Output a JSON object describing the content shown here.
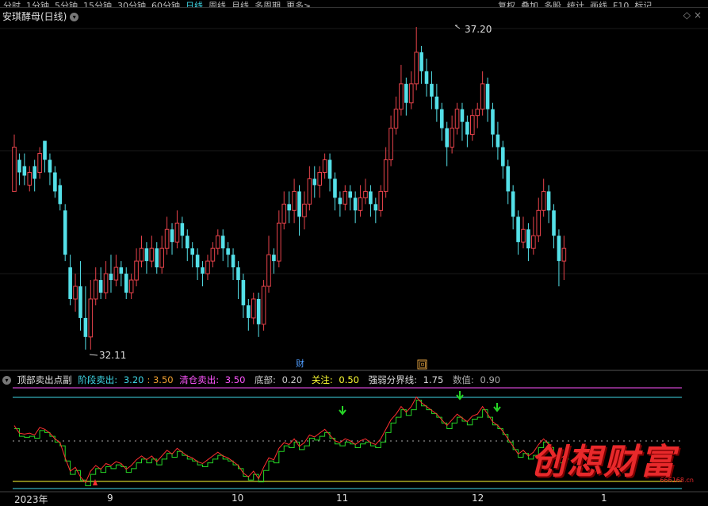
{
  "toolbar": {
    "periods": [
      "分时",
      "1分钟",
      "5分钟",
      "15分钟",
      "30分钟",
      "60分钟",
      "日线",
      "周线",
      "月线",
      "多周期",
      "更多>"
    ],
    "active_period": "日线",
    "right_tools": [
      "复权",
      "叠加",
      "多股",
      "统计",
      "画线",
      "F10",
      "标记"
    ]
  },
  "main_chart": {
    "title": "安琪酵母(日线)",
    "high_label": "37.20",
    "low_label": "32.11",
    "event_marker_cai": "财",
    "event_marker_hui": "回"
  },
  "indicator": {
    "name": "顶部卖出点副",
    "jieduan_label": "阶段卖出:",
    "jieduan_value": "3.20",
    "jieduan_value2": ": 3.50",
    "qingcang_label": "清仓卖出:",
    "qingcang_value": "3.50",
    "dibu_label": "底部:",
    "dibu_value": "0.20",
    "guanzhu_label": "关注:",
    "guanzhu_value": "0.50",
    "qiangruo_label": "强弱分界线:",
    "qiangruo_value": "1.75",
    "shuzhi_label": "数值:",
    "shuzhi_value": "0.90"
  },
  "x_axis": {
    "labels": [
      "2023年",
      "9",
      "10",
      "11",
      "12",
      "1"
    ]
  },
  "watermark": {
    "text": "创想财富",
    "url": "666168.cn"
  },
  "colors": {
    "up": "#e8434b",
    "down": "#54e0e8",
    "active_tab": "#3fd7e6",
    "magenta": "#ff55ff",
    "yellow": "#ffff00",
    "green": "#26d626"
  },
  "chart_data": {
    "type": "candlestick",
    "y_high": 37.2,
    "y_low": 32.11,
    "candles": [
      [
        34.6,
        35.3,
        34.9,
        35.5
      ],
      [
        35.1,
        34.9,
        34.7,
        35.2
      ],
      [
        35.0,
        34.85,
        34.7,
        35.2
      ],
      [
        34.7,
        34.9,
        34.6,
        35.0
      ],
      [
        35.0,
        34.8,
        34.6,
        35.1
      ],
      [
        34.9,
        35.2,
        34.8,
        35.3
      ],
      [
        35.4,
        35.1,
        34.9,
        35.4
      ],
      [
        35.1,
        34.9,
        34.7,
        35.2
      ],
      [
        34.9,
        34.6,
        34.5,
        35.0
      ],
      [
        34.7,
        34.4,
        34.3,
        34.8
      ],
      [
        34.3,
        33.6,
        33.5,
        34.4
      ],
      [
        33.4,
        32.9,
        32.8,
        33.6
      ],
      [
        32.9,
        33.1,
        32.7,
        33.3
      ],
      [
        33.1,
        32.6,
        32.4,
        33.5
      ],
      [
        32.6,
        32.3,
        32.1,
        33.1
      ],
      [
        32.3,
        32.9,
        32.1,
        33.2
      ],
      [
        32.9,
        33.2,
        32.8,
        33.4
      ],
      [
        33.2,
        33.0,
        32.9,
        33.4
      ],
      [
        33.0,
        33.3,
        32.9,
        33.5
      ],
      [
        33.3,
        33.2,
        33.0,
        33.6
      ],
      [
        33.2,
        33.4,
        33.1,
        33.6
      ],
      [
        33.4,
        33.3,
        33.1,
        33.5
      ],
      [
        33.3,
        33.0,
        32.9,
        33.4
      ],
      [
        33.0,
        33.2,
        32.9,
        33.3
      ],
      [
        33.2,
        33.5,
        33.1,
        33.7
      ],
      [
        33.5,
        33.7,
        33.4,
        33.9
      ],
      [
        33.7,
        33.5,
        33.3,
        33.8
      ],
      [
        33.5,
        33.7,
        33.4,
        33.9
      ],
      [
        33.7,
        33.4,
        33.3,
        33.8
      ],
      [
        33.4,
        33.7,
        33.3,
        33.9
      ],
      [
        33.7,
        34.0,
        33.6,
        34.2
      ],
      [
        34.0,
        33.8,
        33.6,
        34.1
      ],
      [
        33.8,
        34.1,
        33.7,
        34.3
      ],
      [
        34.1,
        33.9,
        33.7,
        34.2
      ],
      [
        33.9,
        33.7,
        33.5,
        34.0
      ],
      [
        33.7,
        33.6,
        33.4,
        33.8
      ],
      [
        33.6,
        33.4,
        33.2,
        33.7
      ],
      [
        33.4,
        33.3,
        33.1,
        33.5
      ],
      [
        33.3,
        33.5,
        33.2,
        33.6
      ],
      [
        33.5,
        33.7,
        33.4,
        33.8
      ],
      [
        33.7,
        33.9,
        33.6,
        34.0
      ],
      [
        33.9,
        33.7,
        33.5,
        34.0
      ],
      [
        33.7,
        33.6,
        33.4,
        33.8
      ],
      [
        33.6,
        33.4,
        33.2,
        33.7
      ],
      [
        33.4,
        33.2,
        32.9,
        33.5
      ],
      [
        33.2,
        32.8,
        32.6,
        33.3
      ],
      [
        32.8,
        32.6,
        32.4,
        32.9
      ],
      [
        32.6,
        32.9,
        32.5,
        33.0
      ],
      [
        32.9,
        32.5,
        32.3,
        33.0
      ],
      [
        32.5,
        33.1,
        32.4,
        33.2
      ],
      [
        33.1,
        33.6,
        33.0,
        33.9
      ],
      [
        33.6,
        33.5,
        33.3,
        33.7
      ],
      [
        33.5,
        34.1,
        33.4,
        34.3
      ],
      [
        34.1,
        34.4,
        34.0,
        34.6
      ],
      [
        34.4,
        34.3,
        34.1,
        34.6
      ],
      [
        34.3,
        34.6,
        34.1,
        34.8
      ],
      [
        34.6,
        34.2,
        33.9,
        34.7
      ],
      [
        34.2,
        34.4,
        34.0,
        34.6
      ],
      [
        34.4,
        34.8,
        34.3,
        35.0
      ],
      [
        34.8,
        34.7,
        34.5,
        35.0
      ],
      [
        34.7,
        34.9,
        34.5,
        35.0
      ],
      [
        34.9,
        35.1,
        34.8,
        35.2
      ],
      [
        35.1,
        34.8,
        34.6,
        35.2
      ],
      [
        34.8,
        34.5,
        34.3,
        34.9
      ],
      [
        34.5,
        34.4,
        34.2,
        34.6
      ],
      [
        34.4,
        34.6,
        34.3,
        34.7
      ],
      [
        34.6,
        34.5,
        34.3,
        34.7
      ],
      [
        34.5,
        34.3,
        34.1,
        34.6
      ],
      [
        34.3,
        34.5,
        34.2,
        34.7
      ],
      [
        34.5,
        34.6,
        34.4,
        34.8
      ],
      [
        34.6,
        34.4,
        34.2,
        34.7
      ],
      [
        34.4,
        34.3,
        34.1,
        34.5
      ],
      [
        34.3,
        34.6,
        34.2,
        34.7
      ],
      [
        34.6,
        35.1,
        34.5,
        35.3
      ],
      [
        35.1,
        35.6,
        35.0,
        35.8
      ],
      [
        35.6,
        35.9,
        35.5,
        36.1
      ],
      [
        35.9,
        36.3,
        35.8,
        36.6
      ],
      [
        36.3,
        36.0,
        35.8,
        36.4
      ],
      [
        36.0,
        36.3,
        35.9,
        36.5
      ],
      [
        36.3,
        36.8,
        36.2,
        37.2
      ],
      [
        36.8,
        36.5,
        36.3,
        36.9
      ],
      [
        36.5,
        36.3,
        36.1,
        36.7
      ],
      [
        36.3,
        36.1,
        35.9,
        36.5
      ],
      [
        36.1,
        35.9,
        35.7,
        36.3
      ],
      [
        35.9,
        35.6,
        35.4,
        36.0
      ],
      [
        35.6,
        35.3,
        35.0,
        35.7
      ],
      [
        35.3,
        35.6,
        35.2,
        35.8
      ],
      [
        35.6,
        35.9,
        35.5,
        36.0
      ],
      [
        35.9,
        35.7,
        35.4,
        36.0
      ],
      [
        35.7,
        35.5,
        35.3,
        35.8
      ],
      [
        35.5,
        35.8,
        35.4,
        35.9
      ],
      [
        35.8,
        35.9,
        35.6,
        36.0
      ],
      [
        35.9,
        36.3,
        35.8,
        36.5
      ],
      [
        36.3,
        35.9,
        35.7,
        36.4
      ],
      [
        35.9,
        35.5,
        35.3,
        36.0
      ],
      [
        35.5,
        35.3,
        35.1,
        35.7
      ],
      [
        35.3,
        35.0,
        34.8,
        35.4
      ],
      [
        35.0,
        34.6,
        34.4,
        35.1
      ],
      [
        34.6,
        34.2,
        34.0,
        34.7
      ],
      [
        34.2,
        33.8,
        33.6,
        34.3
      ],
      [
        33.8,
        34.0,
        33.7,
        34.2
      ],
      [
        34.0,
        33.7,
        33.5,
        34.1
      ],
      [
        33.7,
        33.9,
        33.6,
        34.2
      ],
      [
        33.9,
        34.3,
        33.8,
        34.5
      ],
      [
        34.3,
        34.6,
        34.2,
        34.8
      ],
      [
        34.6,
        34.3,
        34.1,
        34.7
      ],
      [
        34.3,
        33.9,
        33.7,
        34.4
      ],
      [
        33.9,
        33.5,
        33.1,
        34.0
      ],
      [
        33.5,
        33.7,
        33.2,
        33.9
      ]
    ]
  }
}
